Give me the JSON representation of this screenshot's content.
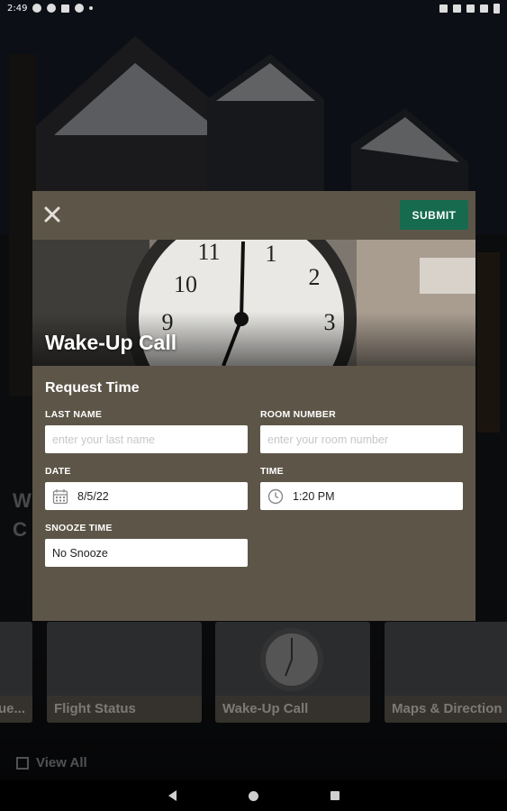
{
  "status_bar": {
    "time": "2:49"
  },
  "background": {
    "partial_text_line1": "W",
    "partial_text_line2": "C",
    "tiles": [
      {
        "caption": "ue..."
      },
      {
        "caption": "Flight Status"
      },
      {
        "caption": "Wake-Up Call"
      },
      {
        "caption": "Maps & Direction"
      }
    ],
    "view_all_label": "View All"
  },
  "modal": {
    "submit_label": "SUBMIT",
    "hero_title": "Wake-Up Call",
    "section_title": "Request Time",
    "fields": {
      "last_name": {
        "label": "LAST NAME",
        "placeholder": "enter your last name"
      },
      "room_number": {
        "label": "ROOM NUMBER",
        "placeholder": "enter your room number"
      },
      "date": {
        "label": "DATE",
        "value": "8/5/22"
      },
      "time": {
        "label": "TIME",
        "value": "1:20 PM"
      },
      "snooze_time": {
        "label": "SNOOZE TIME",
        "value": "No Snooze"
      }
    }
  },
  "colors": {
    "modal_bg": "#5d5648",
    "submit_bg": "#166b4f"
  }
}
